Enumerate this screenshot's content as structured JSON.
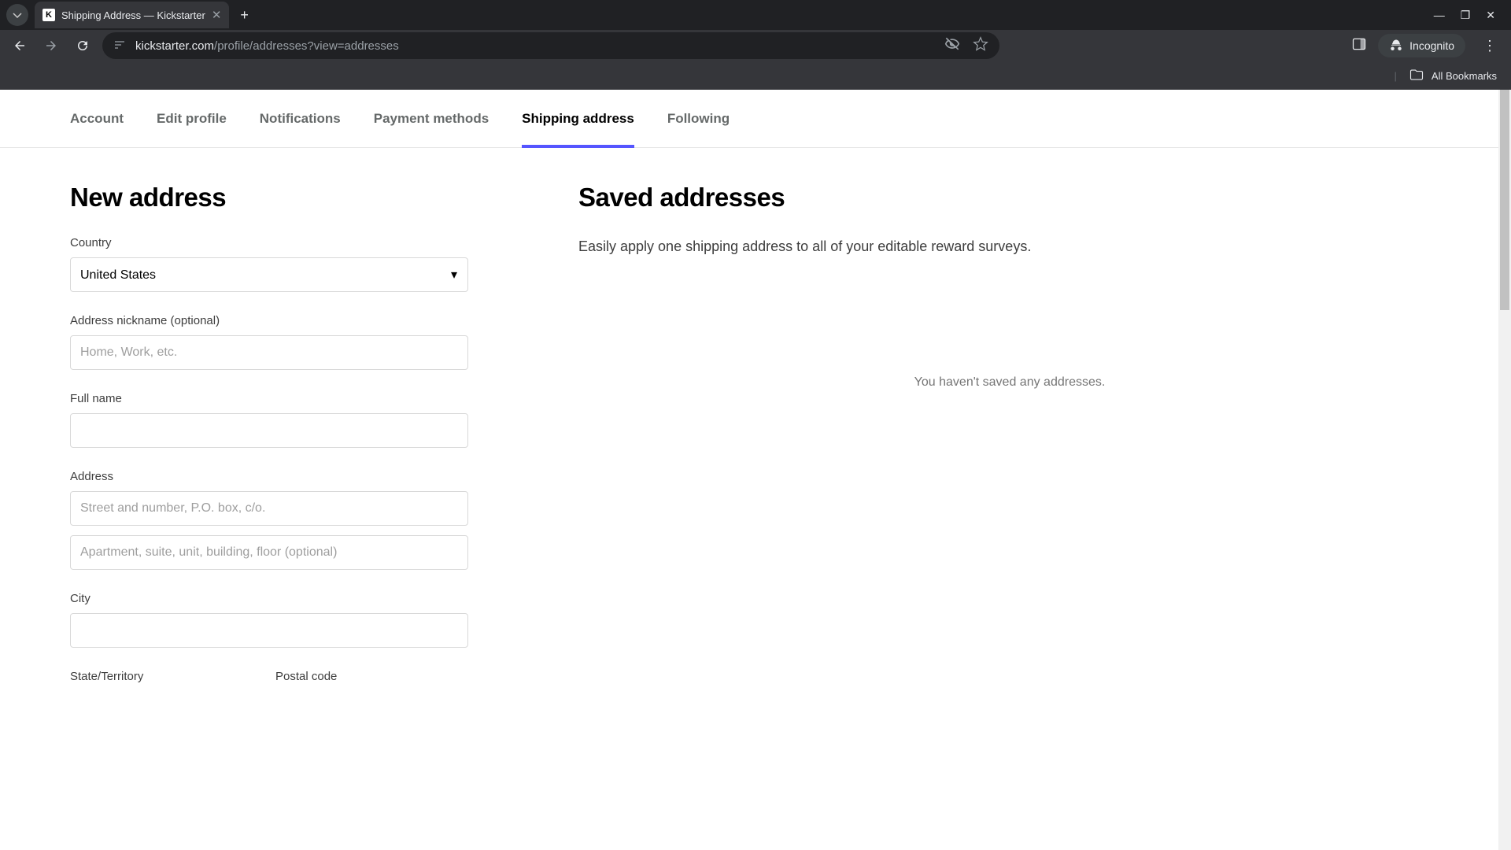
{
  "browser": {
    "tab_title": "Shipping Address — Kickstarter",
    "url_domain": "kickstarter.com",
    "url_path": "/profile/addresses?view=addresses",
    "incognito_label": "Incognito",
    "all_bookmarks": "All Bookmarks"
  },
  "nav_tabs": {
    "account": "Account",
    "edit_profile": "Edit profile",
    "notifications": "Notifications",
    "payment_methods": "Payment methods",
    "shipping_address": "Shipping address",
    "following": "Following"
  },
  "left": {
    "heading": "New address",
    "country_label": "Country",
    "country_value": "United States",
    "nickname_label": "Address nickname (optional)",
    "nickname_placeholder": "Home, Work, etc.",
    "fullname_label": "Full name",
    "address_label": "Address",
    "address_placeholder1": "Street and number, P.O. box, c/o.",
    "address_placeholder2": "Apartment, suite, unit, building, floor (optional)",
    "city_label": "City",
    "state_label": "State/Territory",
    "postal_label": "Postal code"
  },
  "right": {
    "heading": "Saved addresses",
    "desc": "Easily apply one shipping address to all of your editable reward surveys.",
    "empty": "You haven't saved any addresses."
  }
}
